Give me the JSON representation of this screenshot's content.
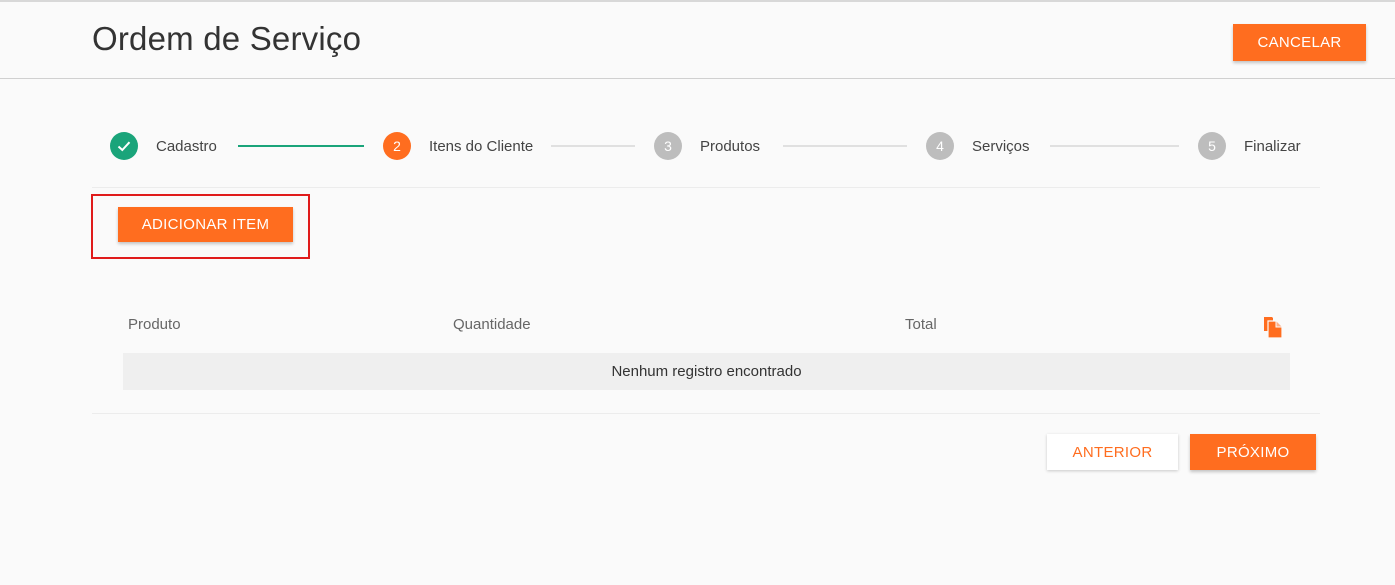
{
  "header": {
    "title": "Ordem de Serviço",
    "cancel_label": "CANCELAR"
  },
  "stepper": {
    "steps": [
      {
        "number": "1",
        "label": "Cadastro",
        "state": "done"
      },
      {
        "number": "2",
        "label": "Itens do Cliente",
        "state": "active"
      },
      {
        "number": "3",
        "label": "Produtos",
        "state": "todo"
      },
      {
        "number": "4",
        "label": "Serviços",
        "state": "todo"
      },
      {
        "number": "5",
        "label": "Finalizar",
        "state": "todo"
      }
    ]
  },
  "actions": {
    "add_item_label": "ADICIONAR ITEM"
  },
  "table": {
    "columns": [
      "Produto",
      "Quantidade",
      "Total"
    ],
    "empty_message": "Nenhum registro encontrado",
    "export_icon": "copy-file-icon"
  },
  "footer": {
    "prev_label": "ANTERIOR",
    "next_label": "PRÓXIMO"
  },
  "colors": {
    "accent": "#ff6d1f",
    "success": "#1aa47a",
    "inactive": "#bdbdbd",
    "highlight": "#e01b1b"
  }
}
